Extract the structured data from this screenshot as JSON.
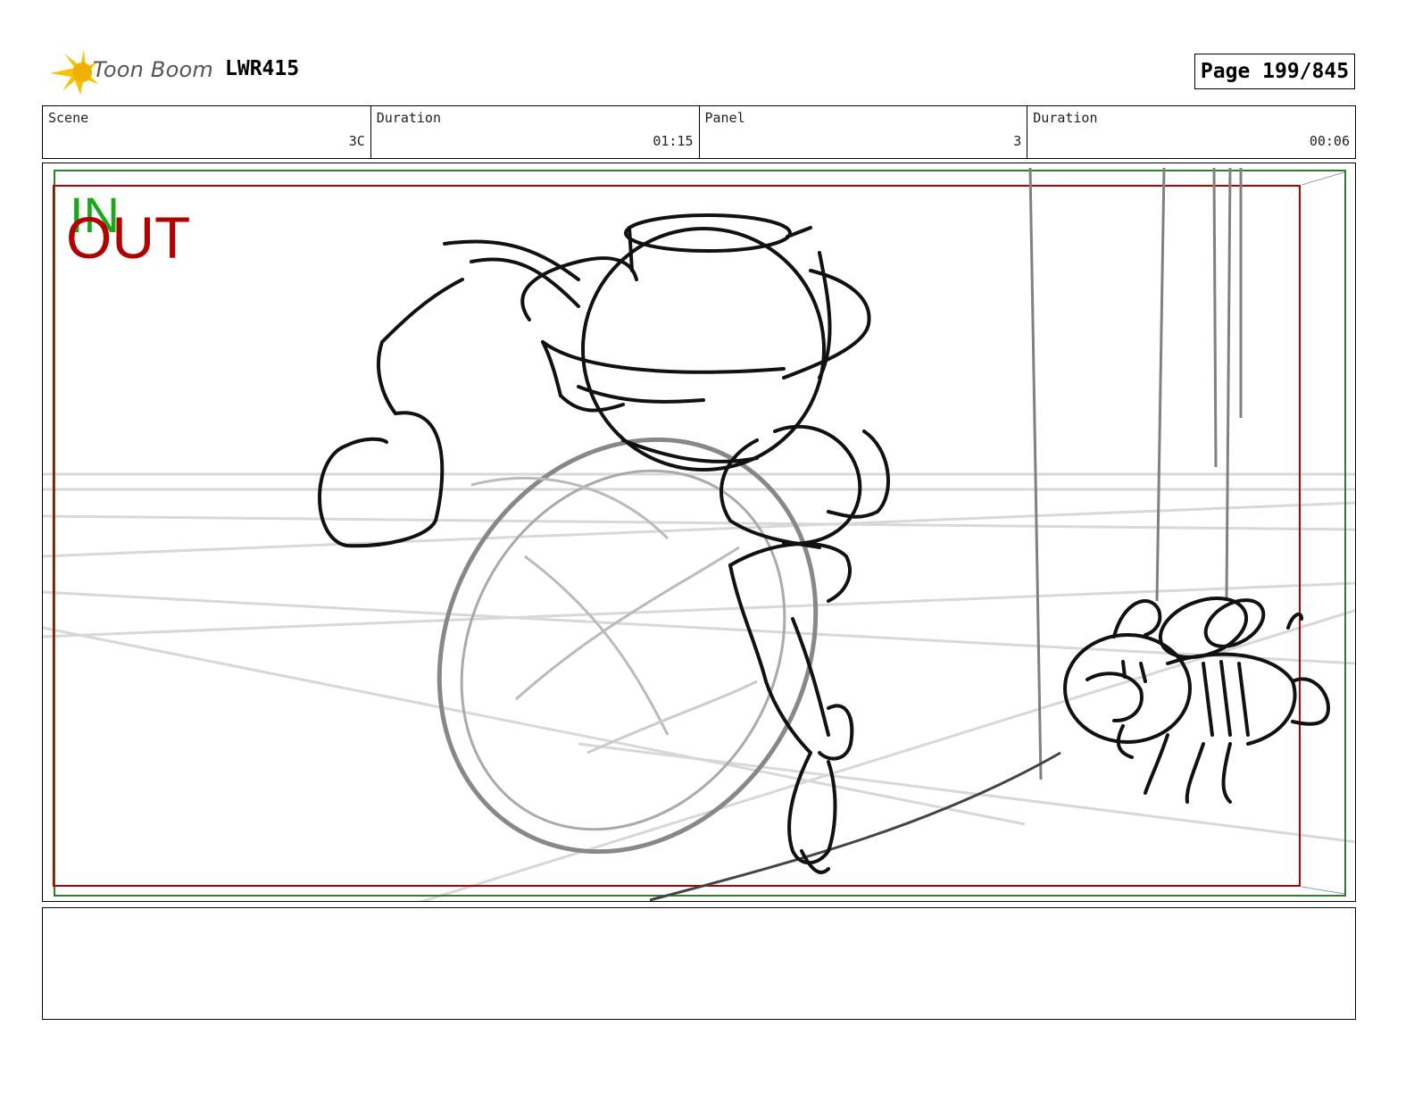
{
  "header": {
    "brand": "Toon Boom",
    "project": "LWR415",
    "page": "Page 199/845"
  },
  "info": {
    "scene_label": "Scene",
    "scene_value": "3C",
    "duration1_label": "Duration",
    "duration1_value": "01:15",
    "panel_label": "Panel",
    "panel_value": "3",
    "duration2_label": "Duration",
    "duration2_value": "00:06"
  },
  "frame": {
    "in_label": "IN",
    "out_label": "OUT"
  },
  "colors": {
    "in_color": "#1aa81a",
    "out_color": "#b00000",
    "logo_color": "#f5c400"
  },
  "notes": {
    "text": ""
  }
}
